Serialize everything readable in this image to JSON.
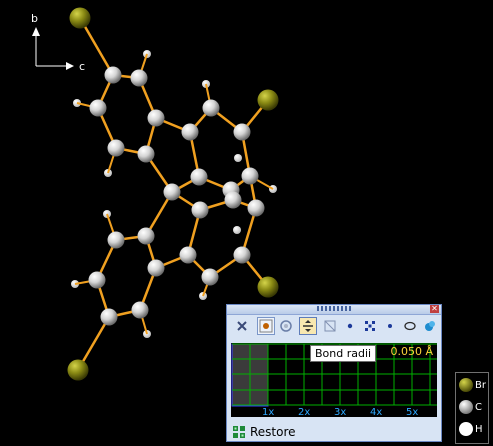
{
  "axes": {
    "b": "b",
    "c": "c"
  },
  "toolbar": {
    "tools": [
      "close-x-icon",
      "sphere-icon",
      "ring-icon",
      "bond-radii-icon",
      "zoom-icon",
      "dot-icon",
      "pattern-icon",
      "atom-icon",
      "ellipse-icon",
      "paint-icon"
    ],
    "tooltip": "Bond radii"
  },
  "plot": {
    "value": "0.050 Å",
    "x_ticks": [
      "1x",
      "2x",
      "3x",
      "4x",
      "5x"
    ]
  },
  "restore": {
    "label": "Restore"
  },
  "legend": {
    "items": [
      {
        "label": "Br",
        "color": "#7a7a10"
      },
      {
        "label": "C",
        "color": "#d0d0d0"
      },
      {
        "label": "H",
        "color": "#ffffff"
      }
    ]
  },
  "colors": {
    "bond": "#f0a020",
    "bromine": "#7a7a10",
    "carbon": "#d8d8d8",
    "hydrogen": "#ffffff"
  }
}
